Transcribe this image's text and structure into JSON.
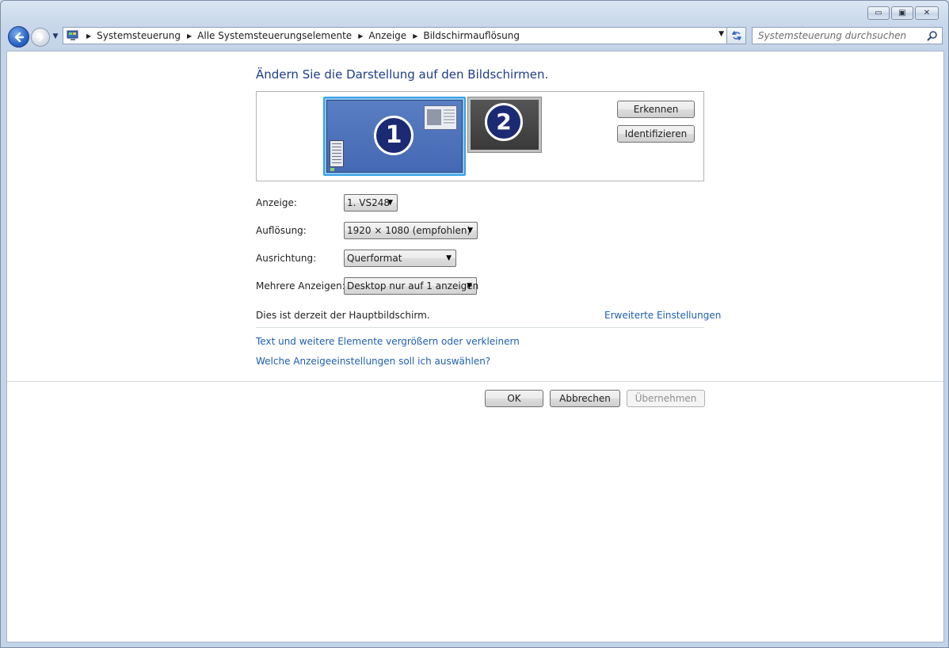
{
  "window": {
    "caption_buttons": {
      "minimize": "▭",
      "maximize": "▣",
      "close": "✕"
    }
  },
  "navbar": {
    "breadcrumbs": [
      "Systemsteuerung",
      "Alle Systemsteuerungselemente",
      "Anzeige",
      "Bildschirmauflösung"
    ],
    "search_placeholder": "Systemsteuerung durchsuchen",
    "icons": [
      "back-arrow-icon",
      "forward-arrow-icon",
      "history-dropdown-icon",
      "control-panel-icon",
      "refresh-icon",
      "search-icon"
    ]
  },
  "main": {
    "heading": "Ändern Sie die Darstellung auf den Bildschirmen.",
    "monitors": [
      {
        "number": "1",
        "selected": true
      },
      {
        "number": "2",
        "selected": false
      }
    ],
    "detect_button": "Erkennen",
    "identify_button": "Identifizieren",
    "display_label": "Anzeige:",
    "display_value": "1. VS248",
    "resolution_label": "Auflösung:",
    "resolution_value": "1920 × 1080 (empfohlen)",
    "orientation_label": "Ausrichtung:",
    "orientation_value": "Querformat",
    "multiple_label": "Mehrere Anzeigen:",
    "multiple_value": "Desktop nur auf 1 anzeigen",
    "info_text": "Dies ist derzeit der Hauptbildschirm.",
    "advanced_link": "Erweiterte Einstellungen",
    "link_text_size": "Text und weitere Elemente vergrößern oder verkleinern",
    "link_which_settings": "Welche Anzeigeeinstellungen soll ich auswählen?"
  },
  "footer": {
    "ok": "OK",
    "cancel": "Abbrechen",
    "apply": "Übernehmen"
  },
  "colors": {
    "heading": "#1e3c8c",
    "link": "#1f5fb1",
    "monitor_selected_border": "#39a2e6",
    "monitor_1_fill": "#4f73ba",
    "monitor_2_fill": "#474747",
    "frame": "#c4d4e8"
  }
}
